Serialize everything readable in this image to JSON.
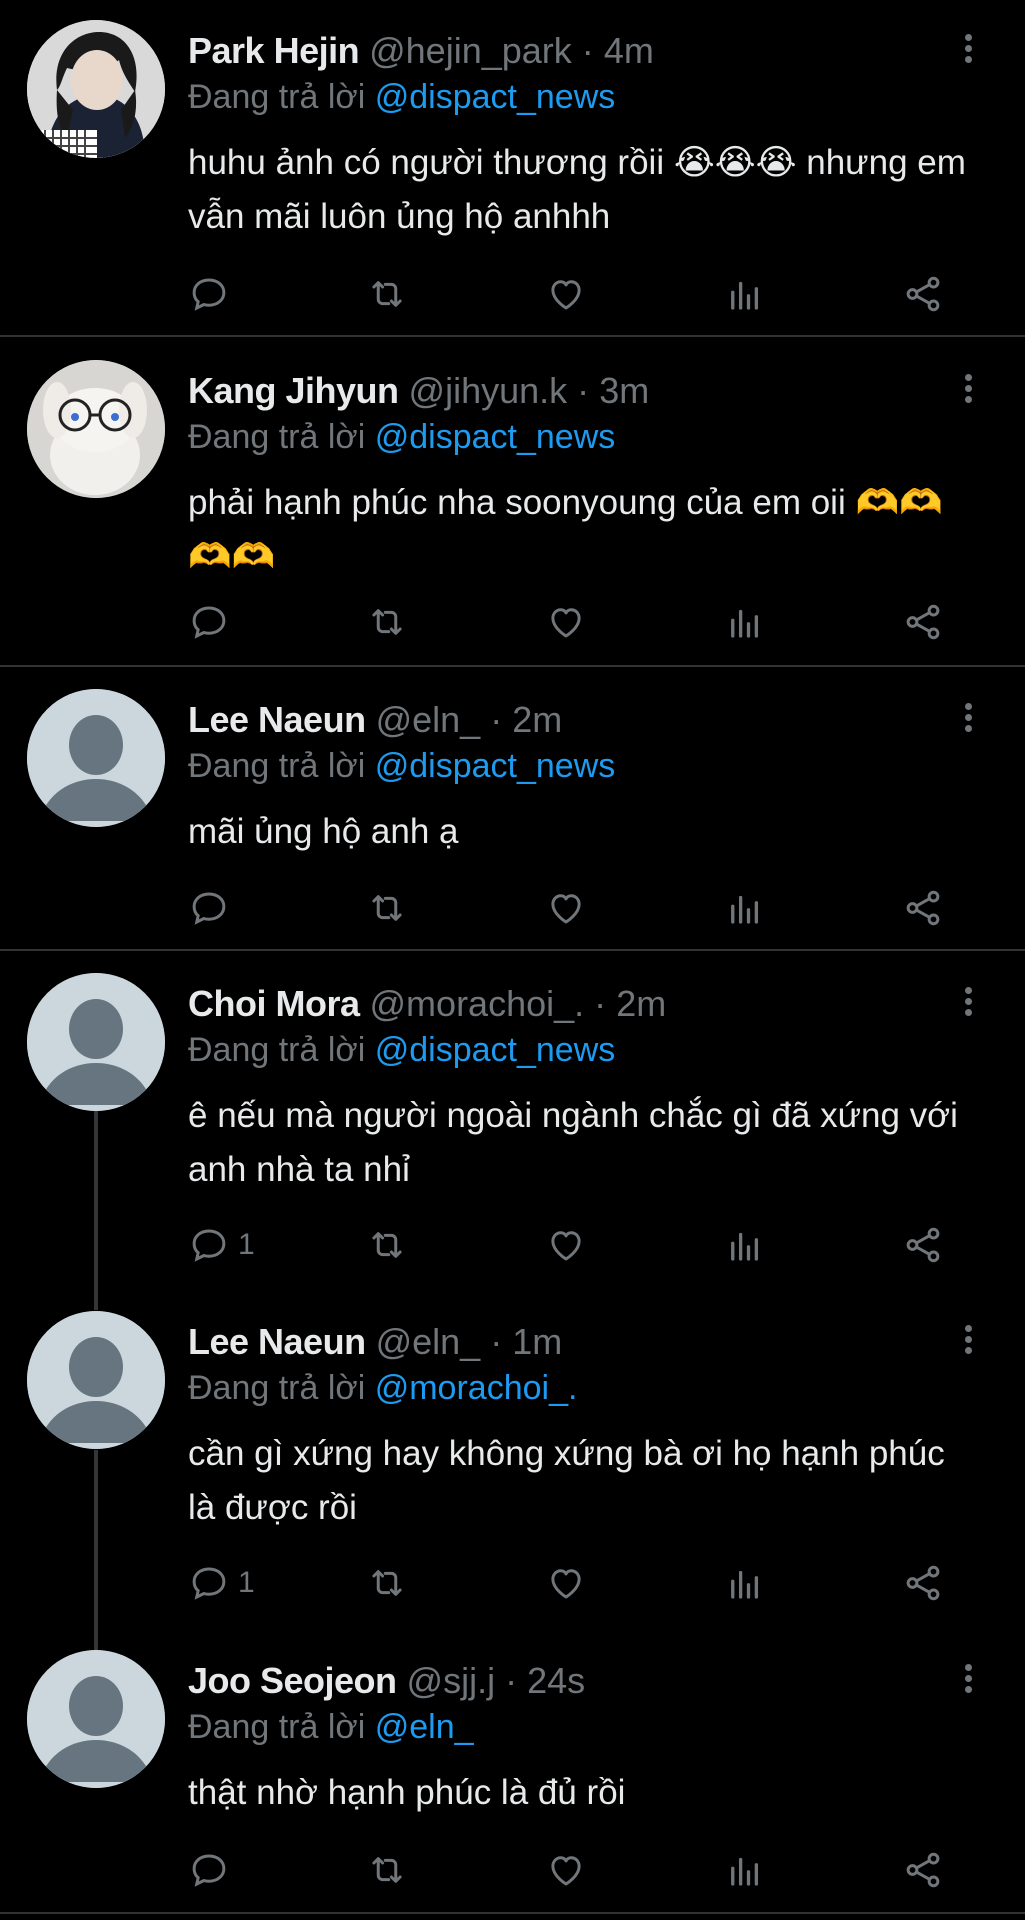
{
  "reply_prefix": "Đang trả lời",
  "tweets": [
    {
      "name": "Park Hejin",
      "handle": "@hejin_park",
      "time": "4m",
      "reply_to": "@dispact_news",
      "text": "huhu ảnh có người thương rồii 😭😭😭 nhưng em vẫn mãi luôn ủng hộ anhhh",
      "replies": "",
      "avatar": "photo-girl"
    },
    {
      "name": "Kang Jihyun",
      "handle": "@jihyun.k",
      "time": "3m",
      "reply_to": "@dispact_news",
      "text": "phải hạnh phúc nha soonyoung của em oii 🫶🫶🫶🫶",
      "replies": "",
      "avatar": "photo-plush"
    },
    {
      "name": "Lee Naeun",
      "handle": "@eln_",
      "time": "2m",
      "reply_to": "@dispact_news",
      "text": "mãi ủng hộ anh ạ",
      "replies": "",
      "avatar": "default"
    },
    {
      "name": "Choi Mora",
      "handle": "@morachoi_.",
      "time": "2m",
      "reply_to": "@dispact_news",
      "text": "ê nếu mà người ngoài ngành chắc gì đã xứng với anh nhà ta nhỉ",
      "replies": "1",
      "avatar": "default"
    },
    {
      "name": "Lee Naeun",
      "handle": "@eln_",
      "time": "1m",
      "reply_to": "@morachoi_.",
      "text": "cần gì xứng hay không xứng bà ơi họ hạnh phúc là được rồi",
      "replies": "1",
      "avatar": "default"
    },
    {
      "name": "Joo Seojeon",
      "handle": "@sjj.j",
      "time": "24s",
      "reply_to": "@eln_",
      "text": "thật nhờ hạnh phúc là đủ rồi",
      "replies": "",
      "avatar": "default"
    }
  ],
  "icons": [
    "reply-icon",
    "retweet-icon",
    "like-icon",
    "views-icon",
    "share-icon",
    "more-icon"
  ],
  "colors": {
    "background": "#000000",
    "text": "#e7e9ea",
    "muted": "#71767b",
    "mention": "#1d9bf0",
    "divider": "#2f3336"
  }
}
